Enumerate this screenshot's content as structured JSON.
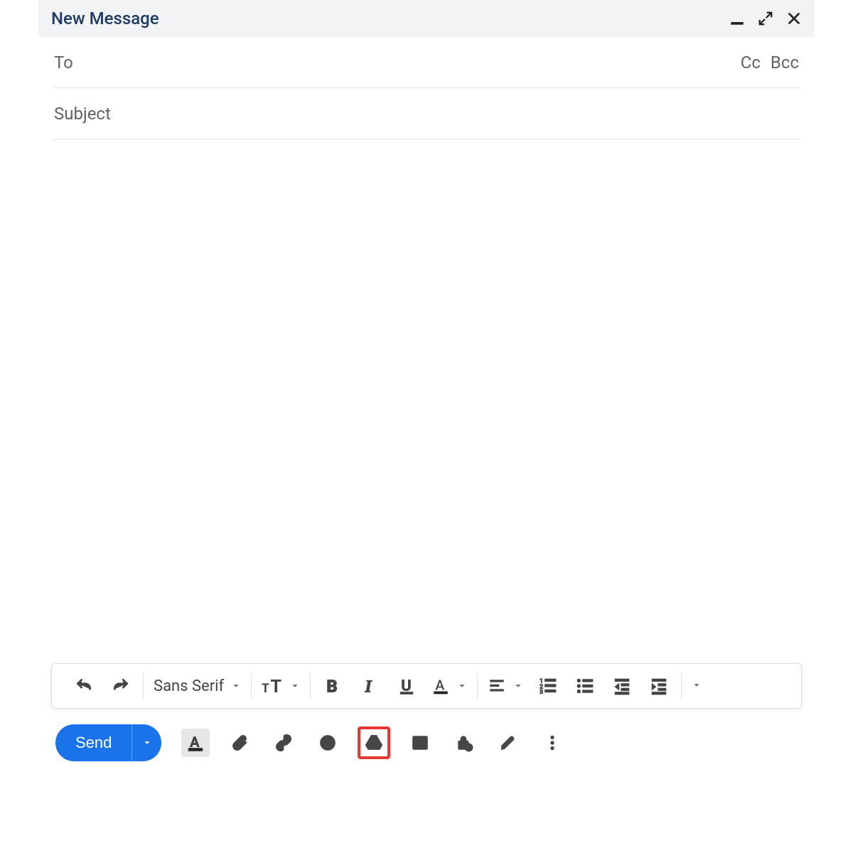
{
  "header": {
    "title": "New Message"
  },
  "fields": {
    "to_label": "To",
    "cc_label": "Cc",
    "bcc_label": "Bcc",
    "subject_placeholder": "Subject"
  },
  "formatting": {
    "font_label": "Sans Serif"
  },
  "actions": {
    "send_label": "Send"
  }
}
